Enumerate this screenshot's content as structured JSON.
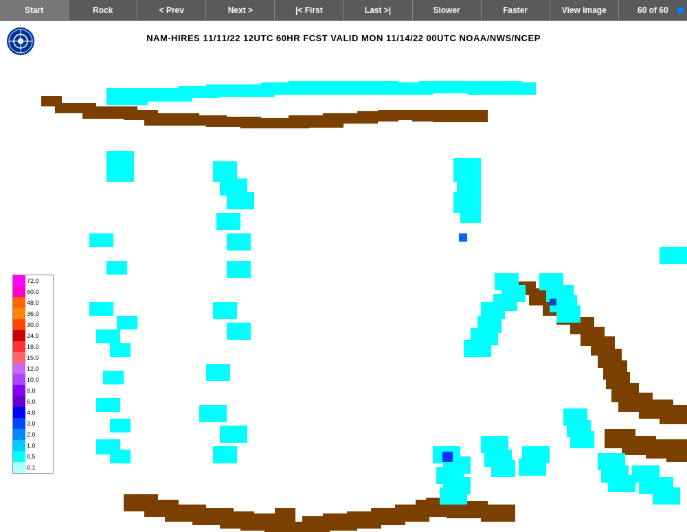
{
  "toolbar": {
    "buttons": [
      {
        "id": "start",
        "label": "Start"
      },
      {
        "id": "rock",
        "label": "Rock"
      },
      {
        "id": "prev",
        "label": "< Prev"
      },
      {
        "id": "next",
        "label": "Next >"
      },
      {
        "id": "first",
        "label": "|< First"
      },
      {
        "id": "last",
        "label": "Last >|"
      },
      {
        "id": "slower",
        "label": "Slower"
      },
      {
        "id": "faster",
        "label": "Faster"
      },
      {
        "id": "view-image",
        "label": "View Image"
      }
    ],
    "counter": "60 of 60"
  },
  "chart": {
    "title": "NAM-HIRES 11/11/22 12UTC 60HR FCST VALID MON 11/14/22 00UTC NOAA/NWS/NCEP"
  },
  "legend": {
    "items": [
      {
        "value": "72.0",
        "color": "#ff00ff"
      },
      {
        "value": "60.0",
        "color": "#ff00cc"
      },
      {
        "value": "48.0",
        "color": "#ff6600"
      },
      {
        "value": "36.0",
        "color": "#ff8800"
      },
      {
        "value": "30.0",
        "color": "#ff4400"
      },
      {
        "value": "24.0",
        "color": "#cc0000"
      },
      {
        "value": "18.0",
        "color": "#ff3333"
      },
      {
        "value": "15.0",
        "color": "#ff6666"
      },
      {
        "value": "12.0",
        "color": "#cc66ff"
      },
      {
        "value": "10.0",
        "color": "#aa44ff"
      },
      {
        "value": "8.0",
        "color": "#8800ff"
      },
      {
        "value": "6.0",
        "color": "#6600cc"
      },
      {
        "value": "4.0",
        "color": "#0000ff"
      },
      {
        "value": "3.0",
        "color": "#0044ff"
      },
      {
        "value": "2.0",
        "color": "#0088ff"
      },
      {
        "value": "1.0",
        "color": "#00ccff"
      },
      {
        "value": "0.5",
        "color": "#00ffff"
      },
      {
        "value": "0.1",
        "color": "#aaffff"
      }
    ]
  }
}
